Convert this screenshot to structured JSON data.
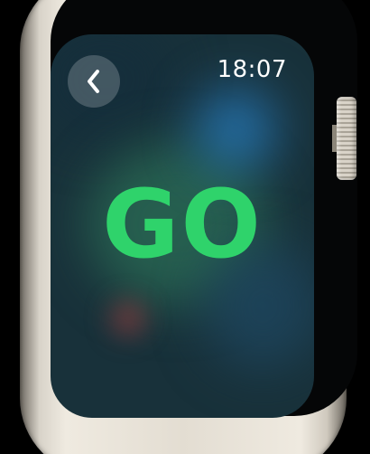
{
  "status_bar": {
    "time": "18:07"
  },
  "main": {
    "status_text": "GO"
  },
  "navigation": {
    "back_icon": "chevron-left-icon"
  },
  "colors": {
    "accent_green": "#2fd36b",
    "background": "#18313a",
    "case": "#e3ddd2"
  }
}
